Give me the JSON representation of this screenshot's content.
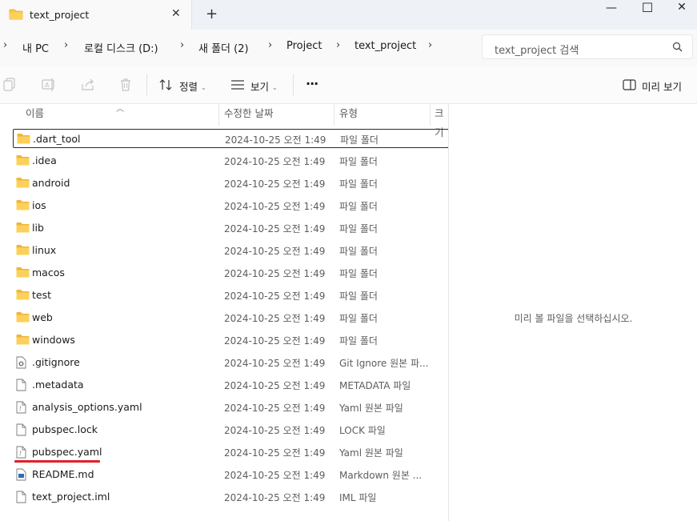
{
  "tab": {
    "title": "text_project",
    "close_glyph": "✕",
    "new_tab_glyph": "+"
  },
  "window_controls": {
    "minimize": "—",
    "maximize": "☐",
    "close": "✕"
  },
  "breadcrumb": [
    "내 PC",
    "로컬 디스크 (D:)",
    "새 폴더 (2)",
    "Project",
    "text_project"
  ],
  "search": {
    "placeholder": "text_project 검색"
  },
  "commandbar": {
    "sort_label": "정렬",
    "view_label": "보기",
    "more_label": "···",
    "preview_label": "미리 보기"
  },
  "columns": {
    "name": "이름",
    "date": "수정한 날짜",
    "type": "유형",
    "size": "크기"
  },
  "files": [
    {
      "name": ".dart_tool",
      "date": "2024-10-25 오전 1:49",
      "type": "파일 폴더",
      "icon": "folder-icon",
      "selected": true
    },
    {
      "name": ".idea",
      "date": "2024-10-25 오전 1:49",
      "type": "파일 폴더",
      "icon": "folder-icon"
    },
    {
      "name": "android",
      "date": "2024-10-25 오전 1:49",
      "type": "파일 폴더",
      "icon": "folder-icon"
    },
    {
      "name": "ios",
      "date": "2024-10-25 오전 1:49",
      "type": "파일 폴더",
      "icon": "folder-icon"
    },
    {
      "name": "lib",
      "date": "2024-10-25 오전 1:49",
      "type": "파일 폴더",
      "icon": "folder-icon"
    },
    {
      "name": "linux",
      "date": "2024-10-25 오전 1:49",
      "type": "파일 폴더",
      "icon": "folder-icon"
    },
    {
      "name": "macos",
      "date": "2024-10-25 오전 1:49",
      "type": "파일 폴더",
      "icon": "folder-icon"
    },
    {
      "name": "test",
      "date": "2024-10-25 오전 1:49",
      "type": "파일 폴더",
      "icon": "folder-icon"
    },
    {
      "name": "web",
      "date": "2024-10-25 오전 1:49",
      "type": "파일 폴더",
      "icon": "folder-icon"
    },
    {
      "name": "windows",
      "date": "2024-10-25 오전 1:49",
      "type": "파일 폴더",
      "icon": "folder-icon"
    },
    {
      "name": ".gitignore",
      "date": "2024-10-25 오전 1:49",
      "type": "Git Ignore 원본 파...",
      "icon": "settings-file-icon"
    },
    {
      "name": ".metadata",
      "date": "2024-10-25 오전 1:49",
      "type": "METADATA 파일",
      "icon": "file-icon"
    },
    {
      "name": "analysis_options.yaml",
      "date": "2024-10-25 오전 1:49",
      "type": "Yaml 원본 파일",
      "icon": "yaml-file-icon"
    },
    {
      "name": "pubspec.lock",
      "date": "2024-10-25 오전 1:49",
      "type": "LOCK 파일",
      "icon": "file-icon"
    },
    {
      "name": "pubspec.yaml",
      "date": "2024-10-25 오전 1:49",
      "type": "Yaml 원본 파일",
      "icon": "yaml-file-icon"
    },
    {
      "name": "README.md",
      "date": "2024-10-25 오전 1:49",
      "type": "Markdown 원본 ...",
      "icon": "markdown-file-icon"
    },
    {
      "name": "text_project.iml",
      "date": "2024-10-25 오전 1:49",
      "type": "IML 파일",
      "icon": "file-icon"
    }
  ],
  "preview": {
    "message": "미리 볼 파일을 선택하십시오."
  },
  "colors": {
    "folder": "#f8c74a",
    "folder_dark": "#e8a92c",
    "annotation": "#e0202a",
    "accent": "#0067c0"
  }
}
